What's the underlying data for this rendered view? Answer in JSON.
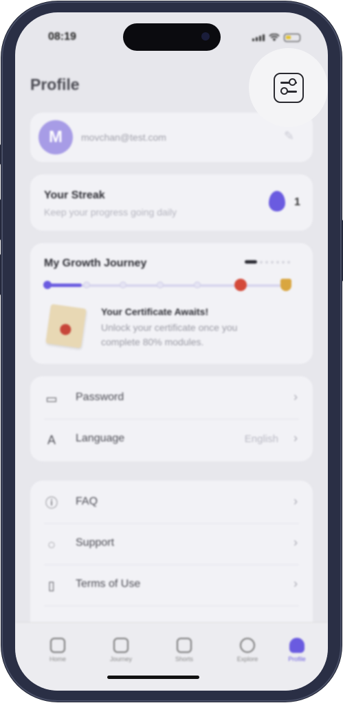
{
  "status": {
    "time": "08:19"
  },
  "page": {
    "title": "Profile"
  },
  "profile": {
    "initial": "M",
    "email": "movchan@test.com"
  },
  "streak": {
    "title": "Your Streak",
    "subtitle": "Keep your progress going daily",
    "count": "1"
  },
  "journey": {
    "title": "My Growth Journey",
    "progress": 0.1,
    "certificate_title": "Your Certificate Awaits!",
    "certificate_text": "Unlock your certificate once you complete 80% modules."
  },
  "settings": {
    "password_label": "Password",
    "language_label": "Language",
    "language_value": "English"
  },
  "help": {
    "faq_label": "FAQ",
    "support_label": "Support",
    "terms_label": "Terms of Use"
  },
  "tabs": [
    {
      "label": "Home"
    },
    {
      "label": "Journey"
    },
    {
      "label": "Shorts"
    },
    {
      "label": "Explore"
    },
    {
      "label": "Profile"
    }
  ],
  "colors": {
    "accent": "#6a5be0",
    "avatar": "#a79ce6"
  },
  "icons": {
    "filter": "sliders-icon"
  }
}
